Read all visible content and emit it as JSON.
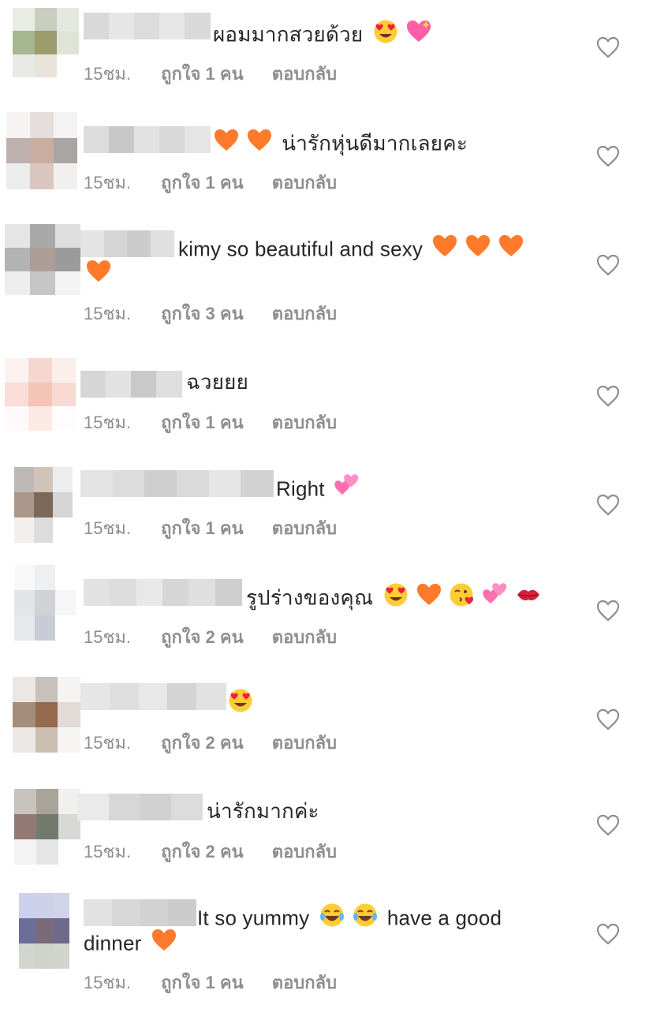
{
  "comments": [
    {
      "text": "ผอมมากสวยด้วย",
      "text2": "",
      "emojis_after": [
        "heart-eyes-emoji",
        "sparkling-heart-emoji"
      ],
      "emojis_before": [],
      "time": "15ชม.",
      "likes": "ถูกใจ 1 คน",
      "reply": "ตอบกลับ",
      "avatar": [
        "#e9ece3",
        "#c9cebe",
        "#e5e8e0",
        "#a6b791",
        "#9a9c6e",
        "#dfe4d6",
        "#e9e9e7",
        "#eae3da",
        "#ffffff"
      ],
      "uname": [
        "#d9d9d9",
        "#e6e6e6",
        "#dcdcdc",
        "#e7e7e7",
        "#d9d9d9"
      ]
    },
    {
      "text": "น่ารักหุ่นดีมากเลยคะ",
      "text2": "",
      "emojis_before": [
        "orange-heart-emoji",
        "orange-heart-emoji"
      ],
      "emojis_after": [],
      "time": "15ชม.",
      "likes": "ถูกใจ 1 คน",
      "reply": "ตอบกลับ",
      "avatar": [
        "#f7f3f3",
        "#e6dedc",
        "#f4f2f2",
        "#bdb0ae",
        "#c9aea0",
        "#a9a5a4",
        "#ececec",
        "#dbc7c0",
        "#f2f0ef"
      ],
      "uname": [
        "#dcdcdc",
        "#c8c8c8",
        "#e2e2e2",
        "#d9d9d9",
        "#e5e5e5"
      ]
    },
    {
      "text": "kimy so beautiful and sexy",
      "text2": "",
      "emojis_before": [],
      "emojis_after": [
        "orange-heart-emoji",
        "orange-heart-emoji",
        "orange-heart-emoji"
      ],
      "emojis_line2": [
        "orange-heart-emoji"
      ],
      "time": "15ชม.",
      "likes": "ถูกใจ 3 คน",
      "reply": "ตอบกลับ",
      "avatar": [
        "#e5e5e5",
        "#a9a9a9",
        "#dedede",
        "#b3b3b3",
        "#ad9e98",
        "#9b9b9b",
        "#eeeeee",
        "#c6c6c6",
        "#f3f3f3"
      ],
      "uname": [
        "#e4e4e4",
        "#d5d5d5",
        "#cccccc",
        "#e0e0e0"
      ]
    },
    {
      "text": "ฉวยยย",
      "text2": "",
      "emojis_before": [],
      "emojis_after": [],
      "time": "15ชม.",
      "likes": "ถูกใจ 1 คน",
      "reply": "ตอบกลับ",
      "avatar": [
        "#fcf3f1",
        "#f6d7cf",
        "#fbefec",
        "#f9ddd6",
        "#f4c4b6",
        "#f8dad2",
        "#fefafa",
        "#fbe9e5",
        "#fefcfc"
      ],
      "uname": [
        "#d6d6d6",
        "#e2e2e2",
        "#c9c9c9",
        "#dedede"
      ]
    },
    {
      "text": "Right",
      "text2": "",
      "emojis_before": [],
      "emojis_after": [
        "two-hearts-emoji"
      ],
      "time": "15ชม.",
      "likes": "ถูกใจ 1 คน",
      "reply": "ตอบกลับ",
      "avatar": [
        "#bdb7b5",
        "#d0c4b9",
        "#eeeeee",
        "#ac988a",
        "#7c6758",
        "#d5d5d5",
        "#f2efed",
        "#dcdcdc",
        "#ffffff"
      ],
      "uname": [
        "#e3e3e3",
        "#dcdcdc",
        "#cfcfcf",
        "#dadada",
        "#e6e6e6",
        "#d2d2d2"
      ]
    },
    {
      "text": "รูปร่างของคุณ",
      "text2": "",
      "emojis_before": [],
      "emojis_after": [
        "heart-eyes-emoji",
        "orange-heart-emoji",
        "kissing-face-emoji",
        "two-hearts-emoji",
        "kiss-mark-emoji"
      ],
      "time": "15ชม.",
      "likes": "ถูกใจ 2 คน",
      "reply": "ตอบกลับ",
      "avatar": [
        "#f8f8f9",
        "#eeeff1",
        "#ffffff",
        "#e3e4e6",
        "#d1d2d6",
        "#f6f6f7",
        "#e8e9ec",
        "#c8ccd6",
        "#ffffff"
      ],
      "uname": [
        "#e2e2e2",
        "#dddddd",
        "#e8e8e8",
        "#d6d6d6",
        "#dfdfdf",
        "#cfcfcf"
      ]
    },
    {
      "text": "",
      "text2": "",
      "emojis_before": [],
      "emojis_after": [
        "heart-eyes-emoji"
      ],
      "time": "15ชม.",
      "likes": "ถูกใจ 2 คน",
      "reply": "ตอบกลับ",
      "avatar": [
        "#ebe7e4",
        "#c7c0bb",
        "#f6f4f3",
        "#a58d7b",
        "#946b4f",
        "#e2dad4",
        "#ebe8e5",
        "#cbbfb2",
        "#f7f5f3"
      ],
      "uname": [
        "#e6e6e6",
        "#dedede",
        "#e8e8e8",
        "#d4d4d4",
        "#e2e2e2"
      ]
    },
    {
      "text": "น่ารักมากค่ะ",
      "text2": "",
      "emojis_before": [],
      "emojis_after": [],
      "time": "15ชม.",
      "likes": "ถูกใจ 2 คน",
      "reply": "ตอบกลับ",
      "avatar": [
        "#c8c3bf",
        "#a8a499",
        "#f0f0ef",
        "#927a73",
        "#717a6d",
        "#d8d8d6",
        "#f3f3f3",
        "#e6e6e6",
        "#ffffff"
      ],
      "uname": [
        "#eaeaea",
        "#d7d7d7",
        "#d1d1d1",
        "#dcdcdc"
      ]
    },
    {
      "text": "It so yummy",
      "text_after": "have a good",
      "text2": "dinner",
      "emojis_before": [],
      "emojis_after": [
        "tears-of-joy-emoji",
        "tears-of-joy-emoji"
      ],
      "emojis_line2": [
        "orange-heart-emoji"
      ],
      "time": "15ชม.",
      "likes": "ถูกใจ 1 คน",
      "reply": "ตอบกลับ",
      "avatar": [
        "#cdd0ec",
        "#cfd1ea",
        "#d1d3ea",
        "#6a6f9a",
        "#7b6a7b",
        "#6e6b8a",
        "#d3d6cf",
        "#cfd3cb",
        "#d1d5cd"
      ],
      "uname": [
        "#e2e2e2",
        "#d8d8d8",
        "#d2d2d2",
        "#cccccc"
      ]
    }
  ]
}
